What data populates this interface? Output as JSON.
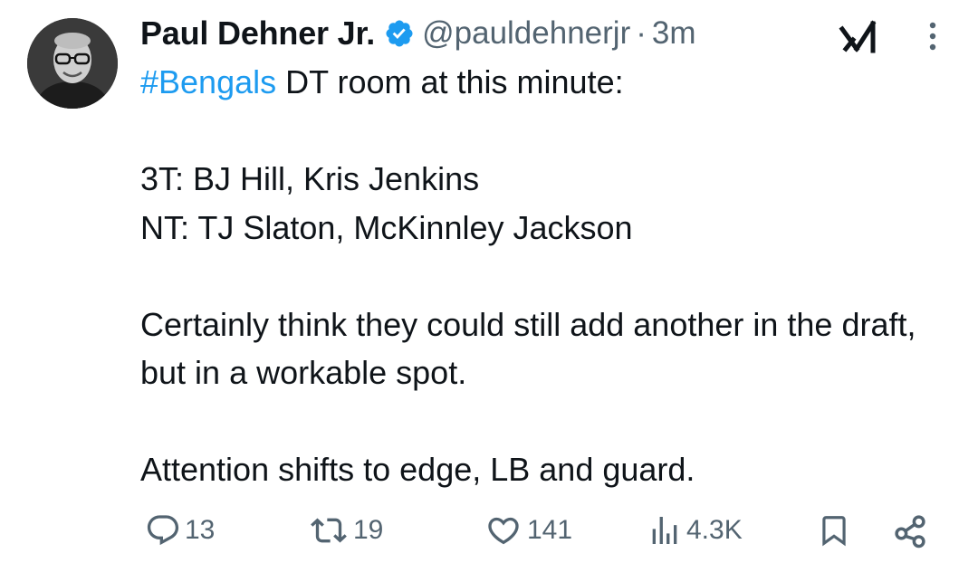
{
  "tweet": {
    "author_name": "Paul Dehner Jr.",
    "handle": "@pauldehnerjr",
    "separator": "·",
    "time": "3m",
    "hashtag": "#Bengals",
    "line1_rest": " DT room at this minute:",
    "line2": "3T: BJ Hill, Kris Jenkins",
    "line3": "NT: TJ Slaton, McKinnley Jackson",
    "line4": "Certainly think they could still add another in the draft, but in a workable spot.",
    "line5": "Attention shifts to edge, LB and guard."
  },
  "metrics": {
    "replies": "13",
    "reposts": "19",
    "likes": "141",
    "views": "4.3K"
  },
  "icons": {
    "verified": "verified-badge-icon",
    "grok": "grok-icon",
    "more": "more-vertical-icon",
    "reply": "reply-icon",
    "repost": "repost-icon",
    "like": "heart-icon",
    "views": "views-icon",
    "bookmark": "bookmark-icon",
    "share": "share-icon"
  },
  "colors": {
    "hashtag": "#1d9bf0",
    "verified": "#1d9bf0",
    "secondary_text": "#536471",
    "primary_text": "#0f1419"
  }
}
